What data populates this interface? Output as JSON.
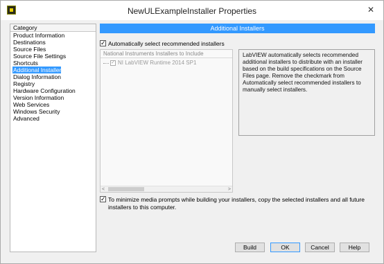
{
  "window": {
    "title": "NewULExampleInstaller Properties",
    "close_glyph": "✕"
  },
  "category": {
    "header": "Category",
    "items": [
      "Product Information",
      "Destinations",
      "Source Files",
      "Source File Settings",
      "Shortcuts",
      "Additional Installers",
      "Dialog Information",
      "Registry",
      "Hardware Configuration",
      "Version Information",
      "Web Services",
      "Windows Security",
      "Advanced"
    ],
    "selected_index": 5
  },
  "main": {
    "header": "Additional Installers",
    "auto_select_label": "Automatically select recommended installers",
    "auto_select_checked": true,
    "installer_list_header": "National Instruments Installers to Include",
    "installers": [
      {
        "label": "NI LabVIEW Runtime 2014 SP1",
        "checked": true
      }
    ],
    "description": "LabVIEW automatically selects recommended additional installers to distribute with an installer based on the build specifications on the Source Files page. Remove the checkmark from Automatically select recommended installers to manually select installers.",
    "minimize_prompts_label": "To minimize media prompts while building your installers, copy the selected installers and all future installers to this computer.",
    "minimize_prompts_checked": true
  },
  "buttons": {
    "build": "Build",
    "ok": "OK",
    "cancel": "Cancel",
    "help": "Help"
  },
  "colors": {
    "accent": "#3399ff"
  }
}
